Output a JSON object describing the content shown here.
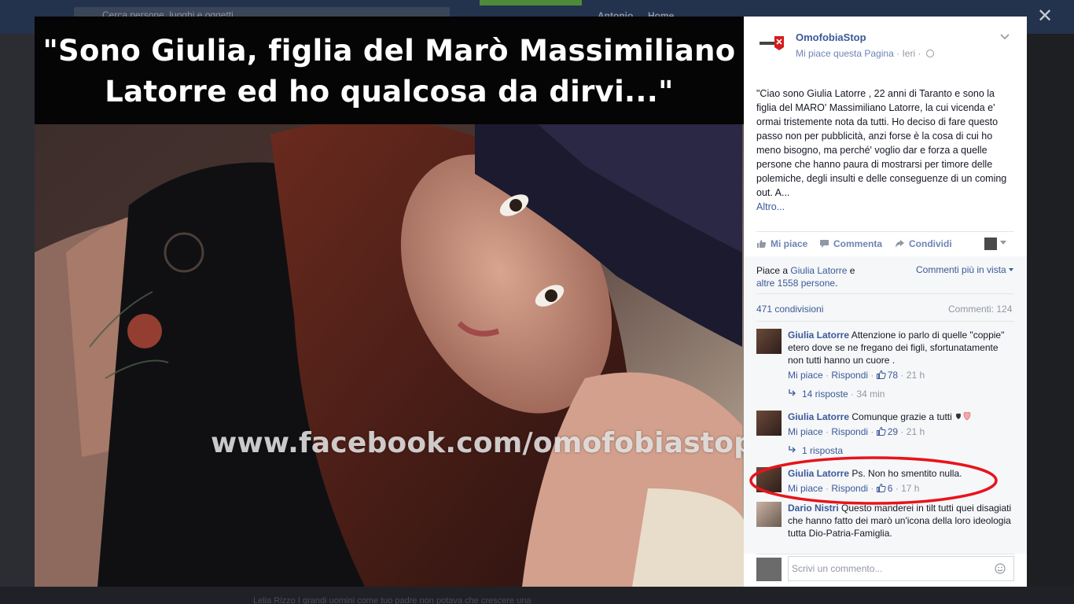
{
  "background": {
    "search_placeholder": "Cerca persone, luoghi e oggetti",
    "topnav": [
      "Antonio",
      "Home"
    ],
    "bottom_text": "Lelia Rizzo I grandi uomini come tuo padre non potava che crescere una"
  },
  "photo": {
    "headline_line1": "\"Sono Giulia, figlia del Marò Massimiliano",
    "headline_line2": "Latorre ed ho qualcosa da dirvi...\"",
    "watermark_url": "www.facebook.com/omofobiastop.it"
  },
  "page": {
    "name": "OmofobiaStop",
    "like_page": "Mi piace questa Pagina",
    "separator": "·",
    "time": "Ieri",
    "post_text": "\"Ciao sono Giulia Latorre , 22 anni di Taranto e sono la figlia del MARO' Massimiliano Latorre, la cui vicenda e' ormai tristemente nota da tutti. Ho deciso di fare questo passo non per pubblicità, anzi forse è la cosa di cui ho meno bisogno, ma perché' voglio dar e forza a quelle persone che hanno paura di mostrarsi per timore delle polemiche, degli insulti e delle conseguenze di un coming out. A...",
    "more": "Altro..."
  },
  "actions": {
    "like": "Mi piace",
    "comment": "Commenta",
    "share": "Condividi"
  },
  "feedback": {
    "likes_prefix": "Piace a ",
    "likes_name": "Giulia Latorre",
    "likes_mid": " e",
    "likes_others": "altre 1558 persone",
    "likes_suffix": ".",
    "top_comments": "Commenti più in vista",
    "shares": "471 condivisioni",
    "comments_count": "Commenti: 124"
  },
  "comments": [
    {
      "author": "Giulia Latorre",
      "text": "Attenzione io parlo di quelle \"coppie\" etero dove se ne fregano dei figli, sfortunatamente non tutti hanno un cuore .",
      "like": "Mi piace",
      "reply": "Rispondi",
      "likes": "78",
      "time": "21 h",
      "replies": "14 risposte",
      "replies_time": "34 min"
    },
    {
      "author": "Giulia Latorre",
      "text": "Comunque grazie a tutti ",
      "like": "Mi piace",
      "reply": "Rispondi",
      "likes": "29",
      "time": "21 h",
      "replies": "1 risposta"
    },
    {
      "author": "Giulia Latorre",
      "text": "Ps. Non ho smentito nulla.",
      "like": "Mi piace",
      "reply": "Rispondi",
      "likes": "6",
      "time": "17 h"
    },
    {
      "author": "Dario Nistri",
      "text": "Questo manderei in tilt tutti quei disagiati che hanno fatto dei marò un'icona della loro ideologia tutta Dio-Patria-Famiglia."
    }
  ],
  "comment_box": {
    "placeholder": "Scrivi un commento..."
  },
  "colors": {
    "link": "#3b5998",
    "annotation": "#e8141b"
  }
}
